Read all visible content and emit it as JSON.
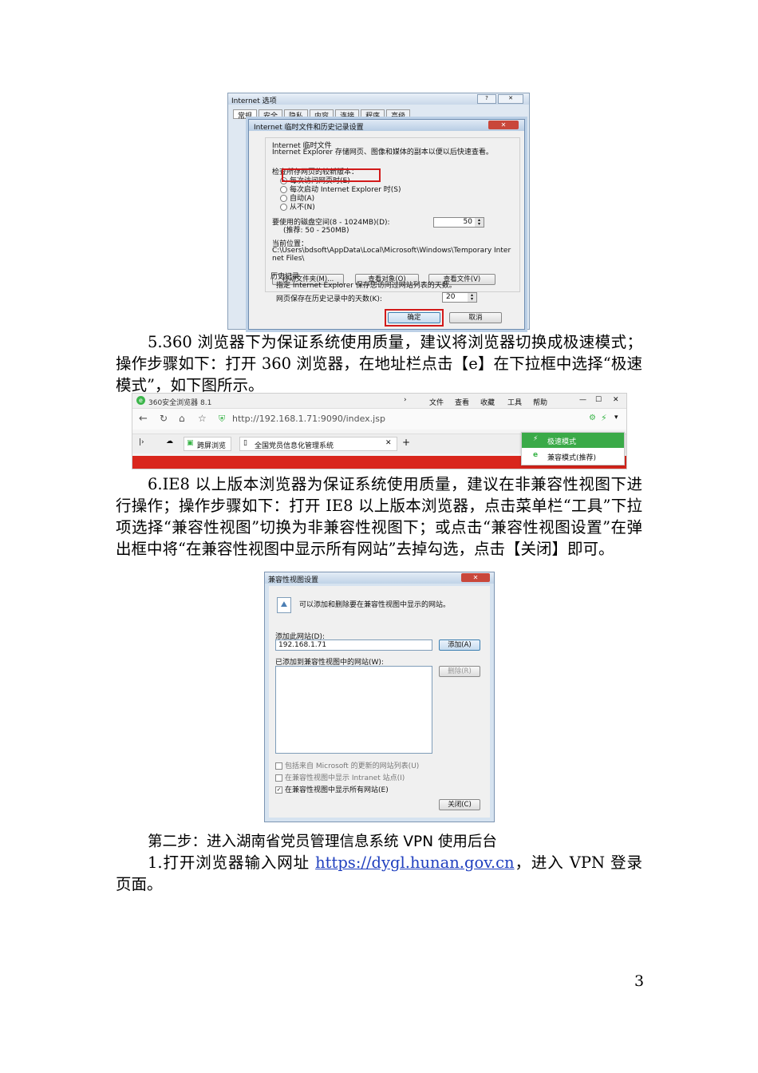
{
  "ie_options": {
    "title": "Internet 选项",
    "tabs": [
      "常规",
      "安全",
      "隐私",
      "内容",
      "连接",
      "程序",
      "高级"
    ],
    "dialog": {
      "title": "Internet 临时文件和历史记录设置",
      "temp_section": "Internet 临时文件",
      "temp_desc": "Internet Explorer 存储网页、图像和媒体的副本以便以后快速查看。",
      "check_label": "检查所存网页的较新版本：",
      "options": [
        "每次访问网页时(E)",
        "每次启动 Internet Explorer 时(S)",
        "自动(A)",
        "从不(N)"
      ],
      "disk_label": "要使用的磁盘空间(8 - 1024MB)(D):",
      "disk_hint": "(推荐: 50 - 250MB)",
      "disk_value": "50",
      "location_label": "当前位置：",
      "location_path": "C:\\Users\\bdsoft\\AppData\\Local\\Microsoft\\Windows\\Temporary Internet Files\\",
      "buttons": [
        "移动文件夹(M)...",
        "查看对象(O)",
        "查看文件(V)"
      ],
      "history_section": "历史记录",
      "history_desc": "指定 Internet Explorer 保存您访问过网站列表的天数。",
      "history_label": "网页保存在历史记录中的天数(K):",
      "history_value": "20",
      "ok": "确定",
      "cancel": "取消"
    }
  },
  "para5": "5.360 浏览器下为保证系统使用质量，建议将浏览器切换成极速模式；操作步骤如下：打开 360 浏览器，在地址栏点击【e】在下拉框中选择“极速模式”，如下图所示。",
  "browser360": {
    "title": "360安全浏览器 8.1",
    "menu": [
      "文件",
      "查看",
      "收藏",
      "工具",
      "帮助"
    ],
    "url": "http://192.168.1.71:9090/index.jsp",
    "tab_split": "跨屏浏览",
    "tab_page": "全国党员信息化管理系统",
    "dropdown": [
      "极速模式",
      "兼容模式(推荐)"
    ]
  },
  "para6": "6.IE8 以上版本浏览器为保证系统使用质量，建议在非兼容性视图下进行操作；操作步骤如下：打开 IE8 以上版本浏览器，点击菜单栏“工具”下拉项选择“兼容性视图”切换为非兼容性视图下；或点击“兼容性视图设置”在弹出框中将“在兼容性视图中显示所有网站”去掉勾选，点击【关闭】即可。",
  "compat": {
    "title": "兼容性视图设置",
    "desc": "可以添加和删除要在兼容性视图中显示的网站。",
    "add_label": "添加此网站(D):",
    "add_value": "192.168.1.71",
    "add_btn": "添加(A)",
    "list_label": "已添加到兼容性视图中的网站(W):",
    "remove_btn": "删除(R)",
    "checks": [
      "包括来自 Microsoft 的更新的网站列表(U)",
      "在兼容性视图中显示 Intranet 站点(I)",
      "在兼容性视图中显示所有网站(E)"
    ],
    "close_btn": "关闭(C)"
  },
  "step2_heading": "第二步：进入湖南省党员管理信息系统 VPN 使用后台",
  "step2_text_pre": "1.打开浏览器输入网址 ",
  "step2_link": "https://dygl.hunan.gov.cn",
  "step2_text_post": "，进入 VPN 登录页面。",
  "page_number": "3"
}
